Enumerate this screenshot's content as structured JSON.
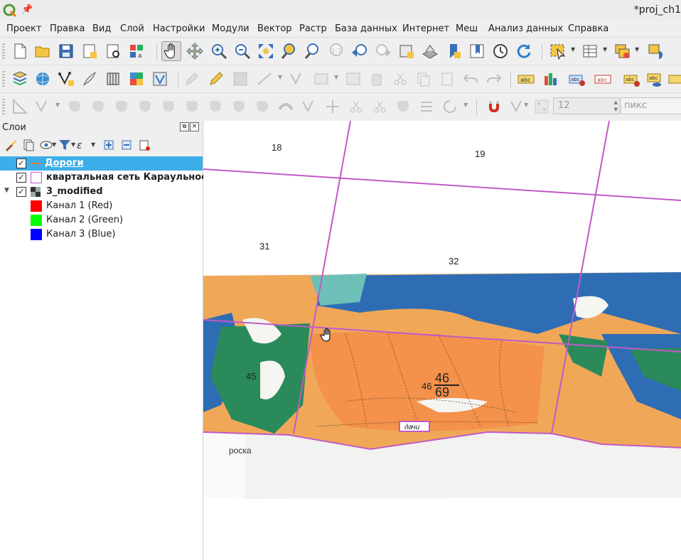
{
  "window": {
    "title": "*proj_ch1"
  },
  "menu": [
    "Проект",
    "Правка",
    "Вид",
    "Слой",
    "Настройки",
    "Модули",
    "Вектор",
    "Растр",
    "База данных",
    "Интернет",
    "Меш",
    "Анализ данных",
    "Справка"
  ],
  "toolbar": {
    "font_size_value": "12",
    "units_placeholder": "пикс",
    "label_icon_text": "abc"
  },
  "panel": {
    "title": "Слои",
    "layers": [
      {
        "name": "Дороги",
        "checked": true,
        "selected": true
      },
      {
        "name": "квартальная сеть Караульное",
        "checked": true
      },
      {
        "name": "3_modified",
        "checked": true,
        "expanded": true,
        "bands": [
          {
            "name": "Канал 1 (Red)",
            "color": "#ff0000"
          },
          {
            "name": "Канал 2 (Green)",
            "color": "#00ff00"
          },
          {
            "name": "Канал 3 (Blue)",
            "color": "#0000ff"
          }
        ]
      }
    ]
  },
  "map": {
    "quarter_labels": [
      "18",
      "19",
      "31",
      "32",
      "45",
      "46"
    ],
    "stand_fraction": {
      "numerator": "46",
      "denominator": "69"
    },
    "dachi_label": "дачи",
    "road_label": "роска",
    "colors": {
      "grid_line": "#c15ac6",
      "orange": "#f0a858",
      "blue": "#2e6db4",
      "green": "#2a8a5a"
    }
  }
}
